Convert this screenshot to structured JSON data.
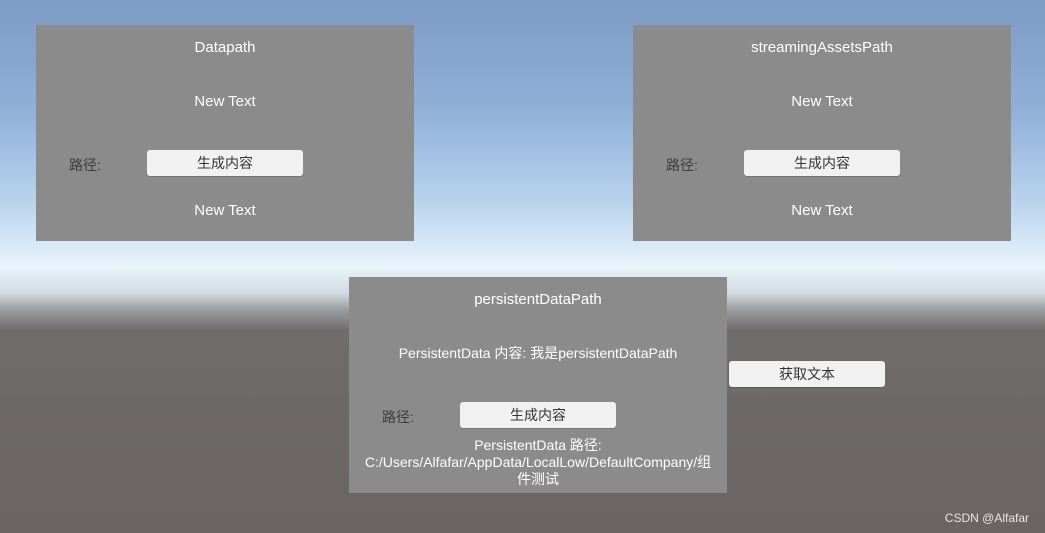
{
  "panels": {
    "datapath": {
      "title": "Datapath",
      "content_text": "New Text",
      "path_label": "路径:",
      "generate_button": "生成内容",
      "path_text": "New Text"
    },
    "streaming": {
      "title": "streamingAssetsPath",
      "content_text": "New Text",
      "path_label": "路径:",
      "generate_button": "生成内容",
      "path_text": "New Text"
    },
    "persistent": {
      "title": "persistentDataPath",
      "content_text": "PersistentData 内容: 我是persistentDataPath",
      "path_label": "路径:",
      "generate_button": "生成内容",
      "path_text_line1": "PersistentData 路径:",
      "path_text_line2": "C:/Users/Alfafar/AppData/LocalLow/DefaultCompany/组",
      "path_text_line3": "件测试"
    }
  },
  "get_text_button": "获取文本",
  "watermark": "CSDN @Alfafar"
}
